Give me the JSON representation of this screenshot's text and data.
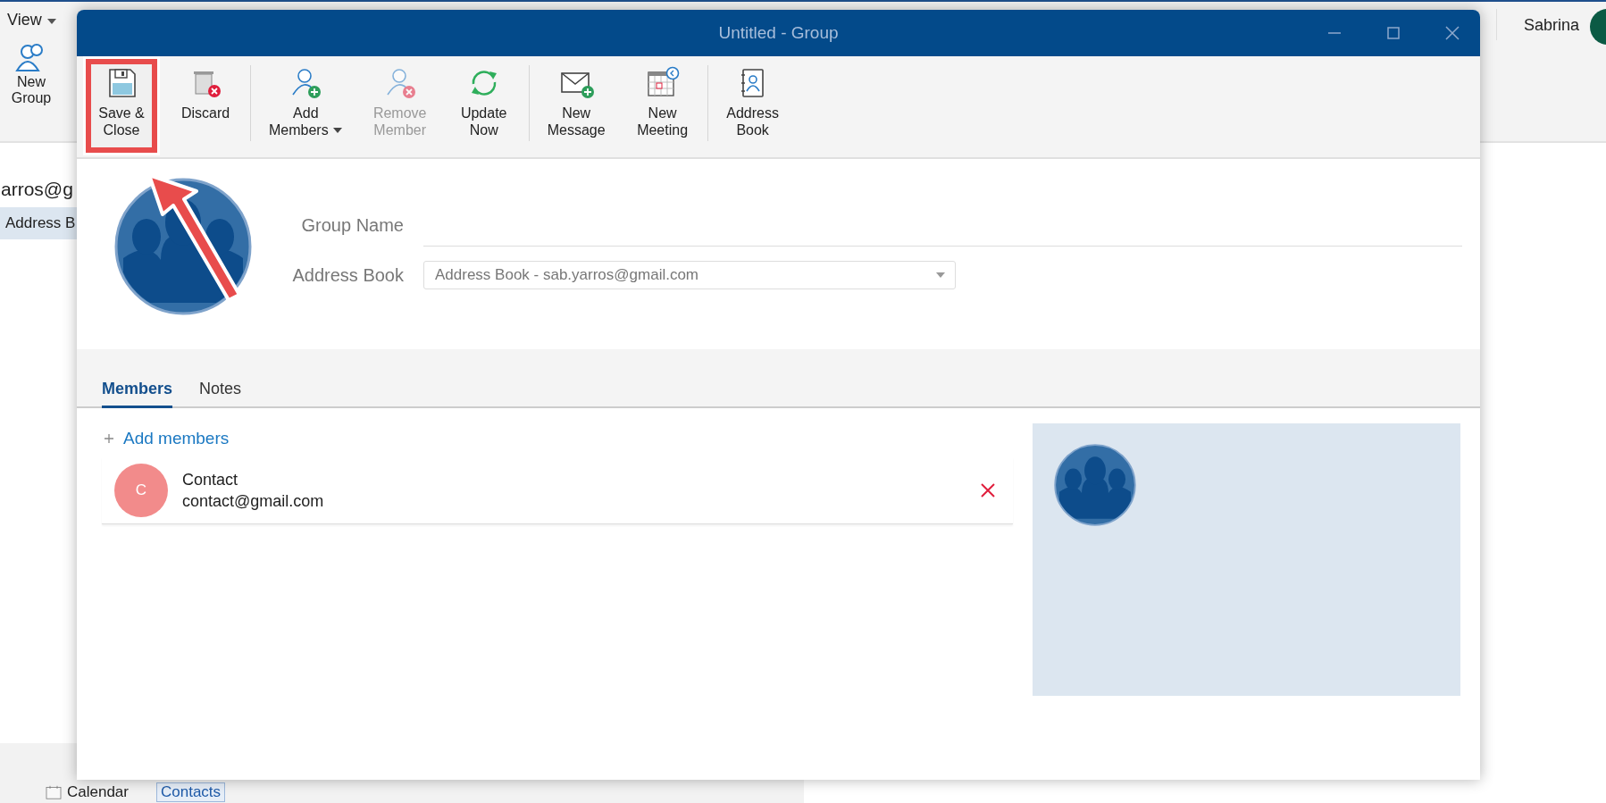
{
  "app": {
    "menu": {
      "label": "View"
    },
    "ribbon": [
      {
        "lines": [
          "New",
          "Group"
        ]
      }
    ],
    "account": {
      "name": "Sabrina"
    },
    "sidebar": {
      "account": "arros@g",
      "items": [
        {
          "label": "Address B",
          "selected": true
        }
      ]
    },
    "nav": [
      {
        "label": "Calendar",
        "selected": false
      },
      {
        "label": "Contacts",
        "selected": true
      }
    ]
  },
  "dialog": {
    "title": "Untitled - Group",
    "ribbon": [
      [
        {
          "lines": [
            "Save &",
            "Close"
          ],
          "kind": "save",
          "disabled": false,
          "dropdown": false,
          "highlighted": true
        },
        {
          "lines": [
            "Discard"
          ],
          "kind": "discard",
          "disabled": false,
          "dropdown": false,
          "highlighted": false
        }
      ],
      [
        {
          "lines": [
            "Add",
            "Members"
          ],
          "kind": "add-member",
          "disabled": false,
          "dropdown": true,
          "highlighted": false
        },
        {
          "lines": [
            "Remove",
            "Member"
          ],
          "kind": "remove-member",
          "disabled": true,
          "dropdown": false,
          "highlighted": false
        },
        {
          "lines": [
            "Update",
            "Now"
          ],
          "kind": "update",
          "disabled": false,
          "dropdown": false,
          "highlighted": false
        }
      ],
      [
        {
          "lines": [
            "New",
            "Message"
          ],
          "kind": "message",
          "disabled": false,
          "dropdown": false,
          "highlighted": false
        },
        {
          "lines": [
            "New",
            "Meeting"
          ],
          "kind": "meeting",
          "disabled": false,
          "dropdown": false,
          "highlighted": false
        }
      ],
      [
        {
          "lines": [
            "Address",
            "Book"
          ],
          "kind": "address-book",
          "disabled": false,
          "dropdown": false,
          "highlighted": false
        }
      ]
    ],
    "group_name": {
      "label": "Group Name"
    },
    "address_book": {
      "label": "Address Book",
      "value": "Address Book - sab.yarros@gmail.com"
    },
    "tabs": [
      {
        "label": "Members",
        "selected": true
      },
      {
        "label": "Notes",
        "selected": false
      }
    ],
    "add_members": "Add members",
    "members": [
      {
        "initial": "C",
        "name": "Contact",
        "email": "contact@gmail.com",
        "color": "#f28b8b"
      }
    ]
  }
}
